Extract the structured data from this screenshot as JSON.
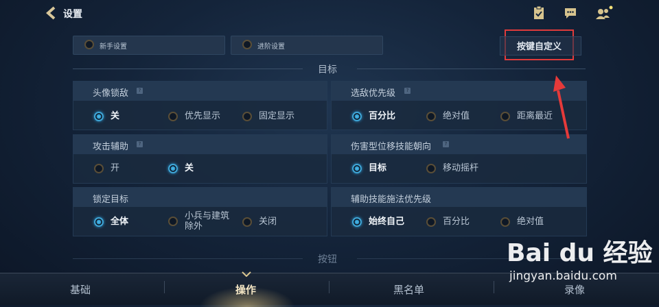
{
  "header": {
    "title": "设置",
    "icons": [
      "back-arrow-icon",
      "clipboard-icon",
      "chat-icon",
      "friends-icon"
    ]
  },
  "modes": {
    "novice": "新手设置",
    "advanced": "进阶设置",
    "key_custom": "按键自定义"
  },
  "section_target": "目标",
  "section_buttons": "按钮",
  "panels": {
    "avatar_lock": {
      "title": "头像锁敌",
      "options": [
        "关",
        "优先显示",
        "固定显示"
      ],
      "selected": 0
    },
    "enemy_priority": {
      "title": "选敌优先级",
      "options": [
        "百分比",
        "绝对值",
        "距离最近"
      ],
      "selected": 0
    },
    "attack_assist": {
      "title": "攻击辅助",
      "options": [
        "开",
        "关"
      ],
      "selected": 1
    },
    "damage_skill_dir": {
      "title": "伤害型位移技能朝向",
      "options": [
        "目标",
        "移动摇杆"
      ],
      "selected": 0
    },
    "lock_target": {
      "title": "锁定目标",
      "options": [
        "全体",
        "小兵与建筑",
        "除外",
        "关闭"
      ],
      "selected": 0
    },
    "assist_skill_priority": {
      "title": "辅助技能施法优先级",
      "options": [
        "始终自己",
        "百分比",
        "绝对值"
      ],
      "selected": 0
    }
  },
  "bottom_tabs": [
    "基础",
    "操作",
    "黑名单",
    "录像"
  ],
  "active_tab": "操作",
  "watermark": {
    "logo": "Bai du 经验",
    "url": "jingyan.baidu.com"
  },
  "colors": {
    "accent": "#3fa7d8",
    "highlight_box": "#e03b3b",
    "active_tab": "#f4e6c4"
  }
}
